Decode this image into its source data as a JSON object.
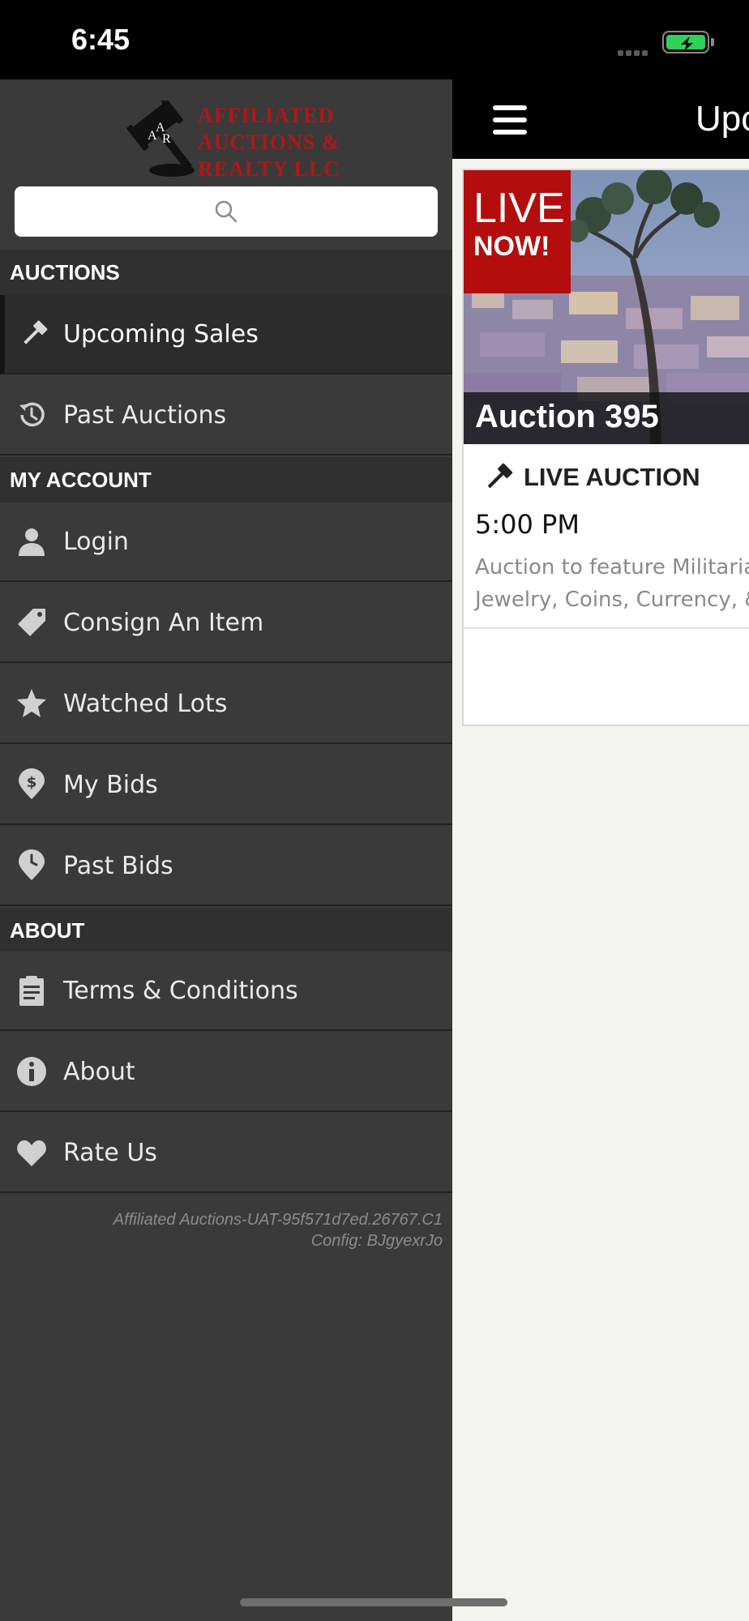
{
  "status_bar": {
    "time": "6:45"
  },
  "sidebar": {
    "logo_text": [
      "AFFILIATED",
      "AUCTIONS &",
      "REALTY LLC"
    ],
    "logo_initials": "AAR",
    "search": {
      "placeholder": ""
    },
    "sections": [
      {
        "header": "AUCTIONS",
        "items": [
          {
            "label": "Upcoming Sales",
            "icon": "gavel-icon",
            "active": true
          },
          {
            "label": "Past Auctions",
            "icon": "history-icon"
          }
        ]
      },
      {
        "header": "MY ACCOUNT",
        "items": [
          {
            "label": "Login",
            "icon": "user-icon"
          },
          {
            "label": "Consign An Item",
            "icon": "tag-icon"
          },
          {
            "label": "Watched Lots",
            "icon": "star-icon"
          },
          {
            "label": "My Bids",
            "icon": "dollar-pin-icon"
          },
          {
            "label": "Past Bids",
            "icon": "clock-pin-icon"
          }
        ]
      },
      {
        "header": "ABOUT",
        "items": [
          {
            "label": "Terms & Conditions",
            "icon": "clipboard-icon"
          },
          {
            "label": "About",
            "icon": "info-icon"
          },
          {
            "label": "Rate Us",
            "icon": "heart-icon"
          }
        ]
      }
    ],
    "version_line1": "Affiliated Auctions-UAT-95f571d7ed.26767.C1",
    "version_line2": "Config: BJgyexrJo"
  },
  "main": {
    "title": "Upcoming Sales",
    "card": {
      "badge_line1": "LIVE",
      "badge_line2": "NOW!",
      "title": "Auction 395",
      "type_label": "LIVE AUCTION",
      "time": "5:00 PM",
      "desc_line1": "Auction to feature Militaria,",
      "desc_line2": "Jewelry, Coins, Currency, &"
    }
  },
  "colors": {
    "sidebar_bg": "#3a3a3a",
    "section_header_bg": "#303030",
    "live_badge": "#b30d0d",
    "logo_red": "#b01818",
    "battery_green": "#2fd158"
  }
}
